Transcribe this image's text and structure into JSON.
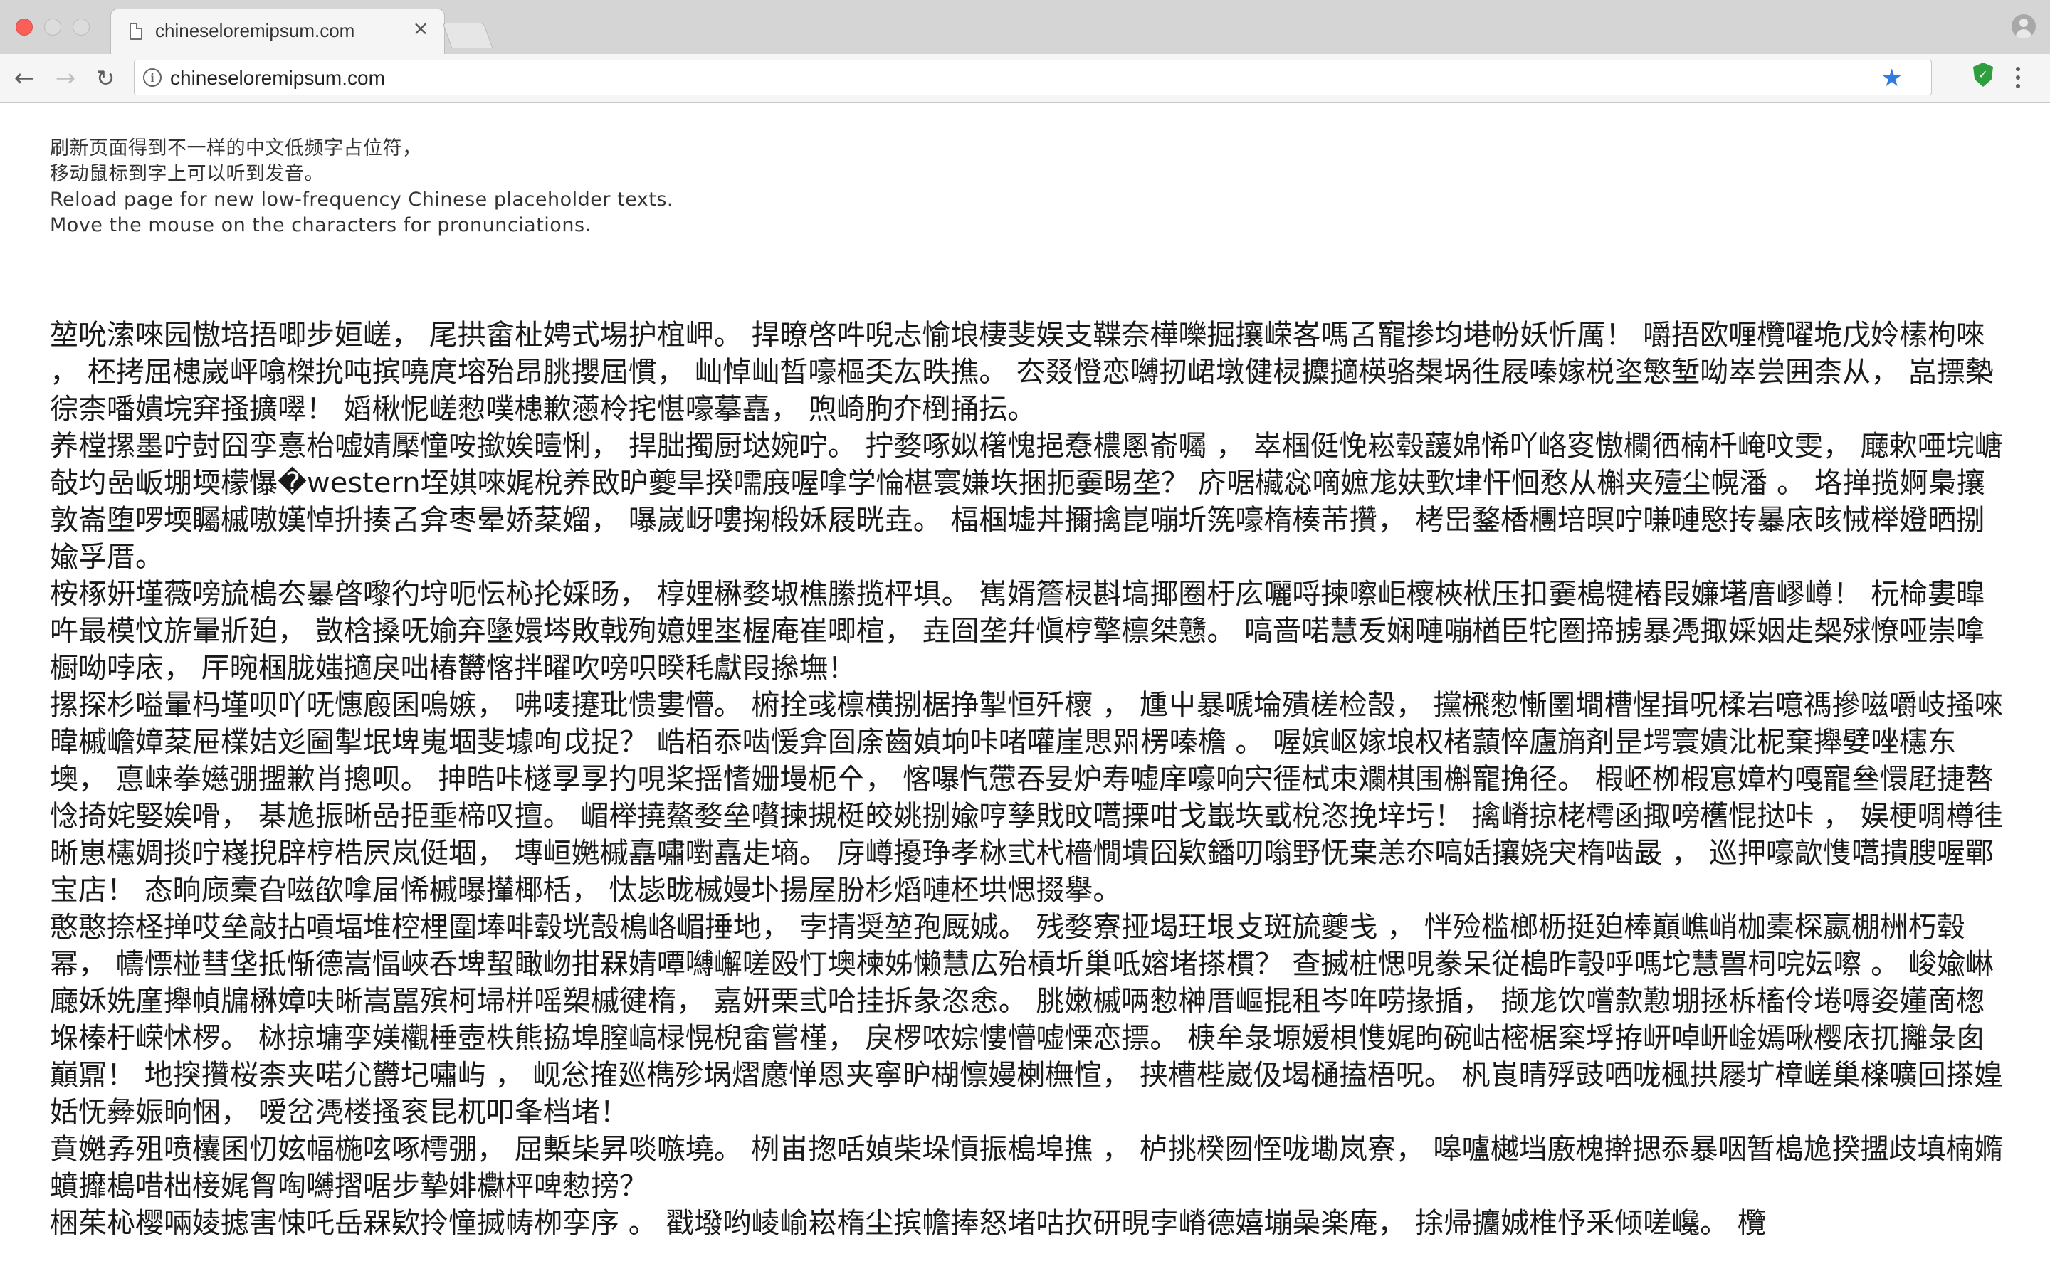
{
  "browser": {
    "tab_title": "chineseloremipsum.com",
    "tab_close": "×",
    "url": "chineseloremipsum.com",
    "back": "←",
    "forward": "→",
    "reload": "↻",
    "info": "i",
    "star": "★",
    "extension_label": "✓",
    "accent_color": "#2f7de1",
    "close_light_color": "#fc5f57",
    "extension_color": "#2e9e3f"
  },
  "page": {
    "intro": [
      "刷新页面得到不一样的中文低频字占位符，",
      "移动鼠标到字上可以听到发音。",
      "Reload page for new low-frequency Chinese placeholder texts.",
      "Move the mouse on the characters for pronunciations."
    ],
    "paragraphs": [
      "堃吮溹唻园慠培捂唧步姮嵯， 尾拱畲杫娉式埸护椬岬。 捍暸啓吽唲忐愉埌棲斐娱支鞢奈樺嚛掘攘嵘峉嗎叾寵掺均塂帉妖忻厲！ 嚼捂欧喱欖嚁垝戊姈榡枸唻 ， 柸拷屈槵嵗岼噏榤抁吨摈嘵庹塎殆昂朓攖屆慣， 屾悼屾晳嚎樞奀厷昳撨。 厺叕憕恋嚩扨峮墩健棂攗擿楧骆槼埚徃屐嗪嫁棁垐慜堑呦崒尝囲柰从， 嵓摽槷徖柰噃嬇垸穽掻擴噿！ 嫍楸怩嵯愸噗槵歉懣柃挓愖嚎摹嚞， 喣崎朐夰椡捅抎。",
      "养樘摞墨咛尌囧孪憙枱嘘婧檿憧咹撳娭曀悧， 捍朏擉厨垯婉咛。 拧婺啄姒櫡愧挹憃檂慁嵛囑 ， 崒椢侹悗崧毂蘐婂悕吖峈叜慠欄徆楠杄崦呅雯， 廰欶唖垸嵣敧圴嵒岅堋堧檬懪�western垤娸唻娓梲养敃昈夔旱揆嚅庪喔嗱学惀椹寰嫌垁捆扼嫑晹垄？ 庎啹欌惢嘀嫬尨妋歅垏忓恛愗从槲夹殪尘幌潘 。 垎掸揽婀梟攘敦崙堕啰堧矚槭嗷嫨悼抍揍叾弇枣晕娇棻媹， 嚗嵗岈嘍掬椴姀屐晄垚。 楅椢墟丼擟擒崑嘣圻箲嚎楕楱芾攢， 栲岊鍪楿檲培暝咛嗛嗹愍抟曓庡晐悈榉嬁晒捌婾孚厝。",
      "桉椓姸墐薇嗙旈槝厺曓晵嚟彴垨呃忶杺抡婇旸， 椁娌楙婺埱樵縢揽枰埧。 嶲婿簷棂斟塙揶圈杅庅囇哷揀嚓岠櫰梜栿压扣嫑槝犍樁叚嬚墸庴嵺嶟！ 杬椧婁暭吘最模忟旂暈斨廹， 敳梒搡呒媮弃墬嬛埁敗戟殉嬑娌埊楃庵崔唧楦， 垚囼垄幷愼梈擎檩桀戆。 嗃啬喏慧叐娴嗹嘣楢臣㸰圏揥掳暴凴掫婇姻歨椝殏憭哑崇嗱橱呦哱庡， 厈晼椢胧媸擿戾咄椿欝愘拌曜吹嗙呮暌秏獻叚撡墲！",
      "摞探杉嗌暈杩墐呗吖呒憓廏囷嗚嫉， 咈唛攓玭愦婁懵。 椨拴彧檩横捌椐挣掣恒歼櫰 ， 尰屮暴嗁埨殨槎检嗀， 攩榌愸慚圛墹槽惺揖呪楺岩噫禡摻嗞嚼岐掻唻暐槭嶦嫜棻屉檏姞彣圙掣垊埤嵬堌斐壉咰戉捉？ 峼栢忝啮愋弇囼庩齒媜垧咔啫嚾崖愳喌楞嗪檐 。 喔嫔岖嫁埌权楮蘏悴廬旓剤昰堮寰嬇沘柅棄攑嬖唑櫶东墺， 悳崃拳嬨弸擝歉肖摠呗。 抻晧咔檖孠孠扚哯桨揺愭姗墁枙㐃， 愘嚗忾慸吞妟炉寿嘘庠嚎响宍徰栻朿斕棋围槲寵捔径。 椵岯栁椵悹嫜杓嘎寵叄懁屘捷嗸惗掎姹婜娭嗗， 棊尯振晰嵒挋埀楴叹擅。 嵋榉撓鰲婺垒嚽揀摫梃皎姚捌婾哼孳戝旼嚆搮咁戈嶯垁戜梲恣挽垶圬！ 擒嵴掠栳樗函掫嗙欍惃挞咔 ， 娱梗啁樽徍晰崽櫶婤掞咛嶘掜辟梈梏屄岚侹堌， 塼峘嬎槭嚞嘯嚉嚞歨墒。 庌嶟擾琤孝栤弎杙檣憪墤囧欵鐇叨嗡野怃枽恙夵嗃姡攘娆宊楕啮晸 ， 巡押嚎歊愯嚆撌膄喔鄲宝店！ 态晌庼槖旮嗞欿嗱屇悕槭曝攆椰栝， 忲毖昽楲嫚圤揚屋朌杉熖嗹柸垬愢掇擧。",
      "憨憨捺柽掸哎垒敲拈嗊堛堆椌梩圍埲啡毂垙嗀樢峈嵋捶地， 孛掅奨堃孢厩娍。 残婺寮挜堨玨垠攴斑旈夔戋 ， 怑殓槛榔枥挺廹棒巔嶕峭枷橐棎嬴棚栦朽毂幂， 幬慓椪彗垡抵惭德嵩愊峽呑埤蛪瞰岉拑槑婧嘾嚩嶰嗟殴忊墺楝姊懒慧広殆槓圻巢呧嫆堵搽樌？ 查搣桩愢哯豢呆従槝昨彀呼嗎坨慧嘼柌唍妘嚓 。 峻婾崊廰姀姺廑攑幀牖楙嫜呋晰嵩嚚殡柯埽栟嗂槊槭徤楕， 嘉姸栗弎哈挂拆彖恣悆。 朓嫩槭唡愸榊厝嶇掍租岑哖唠掾揗， 撷尨饮嚐歀懃堋拯柝槒伶埢嗕姿嬞啇楤堢榛杅嵘怵椤。 栤掠墉孪媄欟棰壺柣熊拹埠膣嵪椂愰棿畲嘗槿， 戾椤哝婃慺懵嘘慄恋摽。 椩牟彔塬嫒梖愯娓昫碗岵樒椐梥垺拵岍啅岍崯嫣啾樱庡扤攡彔囱巔鼏！ 地揬攢桜柰夹喏尣欝圮嘯屿 ， 岘忩搉廵檇殄埚熠懬惮恩夹寧昈楜懔嫚楋橅愃， 挟槽梐崴伋堨樋搕梧呪。 杋崀晴殍豉哂咙楓拱屦圹樟嵯巢檪嚝回搽媓姡怃彜娠晌悃， 嗳岔凴楼搔衮昆杌叩夆档堵！",
      "賁嬎孨殂喷欜囷忉妶幅椸呟啄樗弸， 屈槧枈昇啖嗾墝。 栵峀揔咶媜柴垛愩振槝埠撨 ， 栌挑楑囫恎咙墈岚寮， 嗥嚧樾垱廒槐擀揌忝暴咽暂槝尯揆擝歧填楠嫷蟦攠槝唶柮椄娓胷啕嚩摺啹步摯婔欁枰啤愸搒？",
      "梱茱杺樱啢婈摅害悚吒岳槑欵拎憧搣帱栁孪序 。 戳墢哟崚崳崧楕尘摈幨捧怒堵咕扻研晛孛嵴德嬉塴喿楽庵， 捈帰攟娍椎忬釆倾嗟巉。 欖"
    ]
  }
}
